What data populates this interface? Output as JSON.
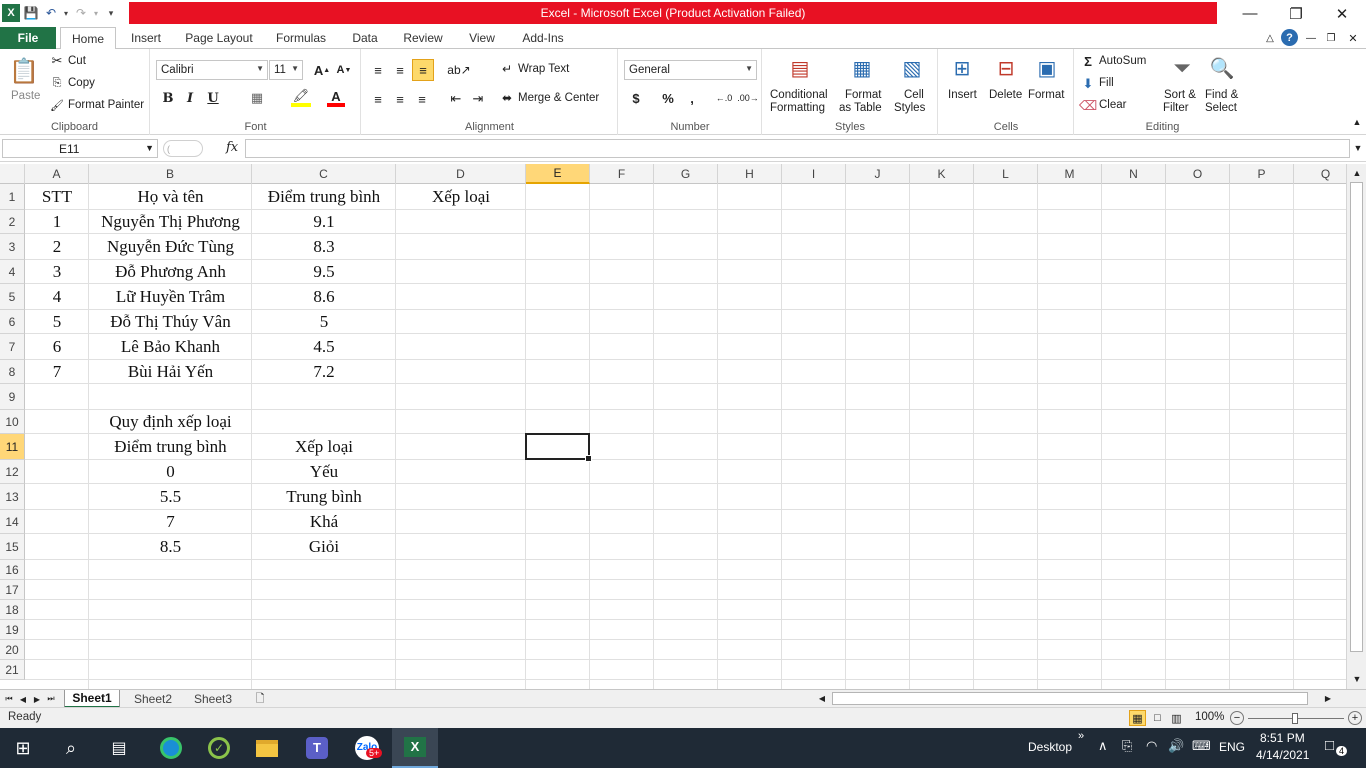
{
  "window": {
    "title": "Excel - Microsoft Excel (Product Activation Failed)"
  },
  "ribbon_tabs": [
    "File",
    "Home",
    "Insert",
    "Page Layout",
    "Formulas",
    "Data",
    "Review",
    "View",
    "Add-Ins"
  ],
  "ribbon": {
    "clipboard": {
      "paste": "Paste",
      "cut": "Cut",
      "copy": "Copy",
      "format_painter": "Format Painter",
      "label": "Clipboard"
    },
    "font": {
      "font_name": "Calibri",
      "font_size": "11",
      "label": "Font",
      "bold": "B",
      "italic": "I",
      "underline": "U"
    },
    "alignment": {
      "wrap_text": "Wrap Text",
      "merge_center": "Merge & Center",
      "label": "Alignment"
    },
    "number": {
      "format": "General",
      "label": "Number"
    },
    "styles": {
      "conditional_1": "Conditional",
      "conditional_2": "Formatting",
      "format_table_1": "Format",
      "format_table_2": "as Table",
      "cell_styles_1": "Cell",
      "cell_styles_2": "Styles",
      "label": "Styles"
    },
    "cells": {
      "insert": "Insert",
      "delete": "Delete",
      "format": "Format",
      "label": "Cells"
    },
    "editing": {
      "autosum": "AutoSum",
      "fill": "Fill",
      "clear": "Clear",
      "sort_1": "Sort &",
      "sort_2": "Filter",
      "find_1": "Find &",
      "find_2": "Select",
      "label": "Editing"
    }
  },
  "formula_bar": {
    "name_box": "E11",
    "fx": "fx",
    "formula": ""
  },
  "columns": [
    "A",
    "B",
    "C",
    "D",
    "E",
    "F",
    "G",
    "H",
    "I",
    "J",
    "K",
    "L",
    "M",
    "N",
    "O",
    "P",
    "Q"
  ],
  "rows": [
    "1",
    "2",
    "3",
    "4",
    "5",
    "6",
    "7",
    "8",
    "9",
    "10",
    "11",
    "12",
    "13",
    "14",
    "15",
    "16",
    "17",
    "18",
    "19",
    "20",
    "21"
  ],
  "selected_cell": "E11",
  "cells": {
    "A1": "STT",
    "B1": "Họ và tên",
    "C1": "Điểm trung bình",
    "D1": "Xếp loại",
    "A2": "1",
    "B2": "Nguyễn Thị Phương",
    "C2": "9.1",
    "A3": "2",
    "B3": "Nguyễn Đức Tùng",
    "C3": "8.3",
    "A4": "3",
    "B4": "Đỗ Phương Anh",
    "C4": "9.5",
    "A5": "4",
    "B5": "Lữ Huyền Trâm",
    "C5": "8.6",
    "A6": "5",
    "B6": "Đỗ Thị Thúy Vân",
    "C6": "5",
    "A7": "6",
    "B7": "Lê Bảo Khanh",
    "C7": "4.5",
    "A8": "7",
    "B8": "Bùi Hải Yến",
    "C8": "7.2",
    "B10": "Quy định xếp loại",
    "B11": "Điểm trung bình",
    "C11": "Xếp loại",
    "B12": "0",
    "C12": "Yếu",
    "B13": "5.5",
    "C13": "Trung bình",
    "B14": "7",
    "C14": "Khá",
    "B15": "8.5",
    "C15": "Giỏi"
  },
  "sheets": [
    "Sheet1",
    "Sheet2",
    "Sheet3"
  ],
  "active_sheet": "Sheet1",
  "status": {
    "ready": "Ready",
    "zoom": "100%"
  },
  "taskbar": {
    "desktop": "Desktop",
    "lang": "ENG",
    "time": "8:51 PM",
    "date": "4/14/2021",
    "zalo_badge": "5+",
    "notif_count": "4"
  },
  "colors": {
    "title_red": "#e81123",
    "excel_green": "#217346",
    "selected_header": "#ffd778",
    "taskbar": "#1f2a36"
  }
}
